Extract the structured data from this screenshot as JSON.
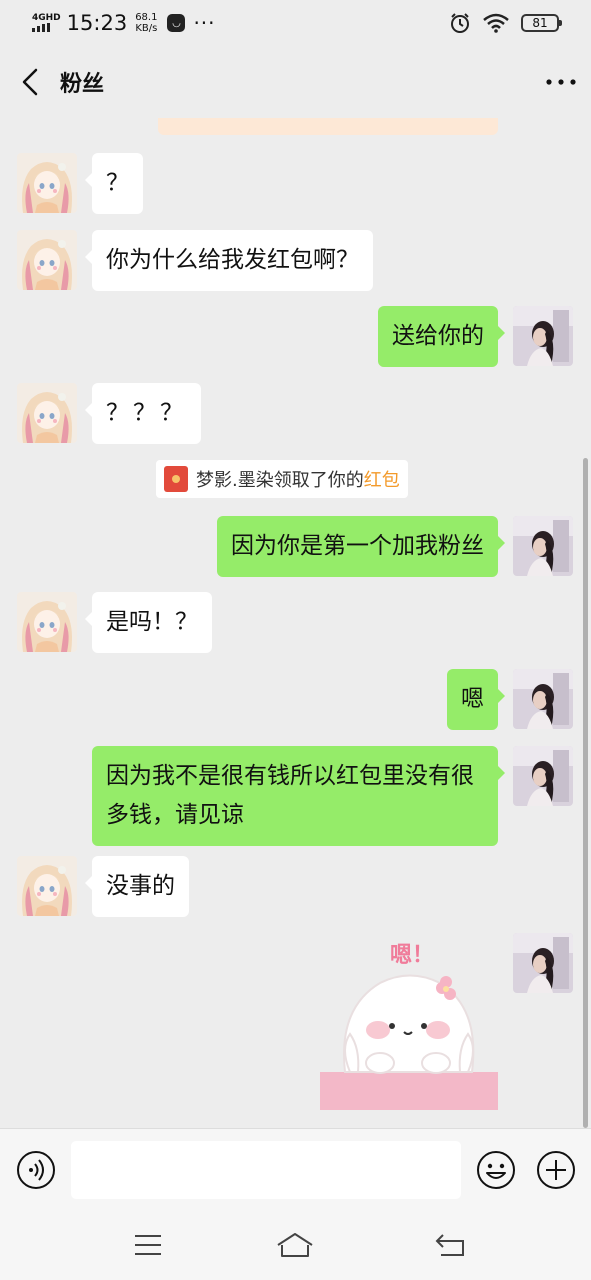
{
  "status_bar": {
    "network": "4GHD",
    "time": "15:23",
    "speed_value": "68.1",
    "speed_unit": "KB/s",
    "battery": "81"
  },
  "header": {
    "title": "粉丝"
  },
  "messages": [
    {
      "side": "in",
      "text": "？"
    },
    {
      "side": "in",
      "text": "你为什么给我发红包啊？"
    },
    {
      "side": "out",
      "text": "送给你的"
    },
    {
      "side": "in",
      "text": "？？？"
    },
    {
      "side": "out",
      "text": "因为你是第一个加我粉丝"
    },
    {
      "side": "in",
      "text": "是吗！？"
    },
    {
      "side": "out",
      "text": "嗯"
    },
    {
      "side": "out",
      "text": "因为我不是很有钱所以红包里没有很多钱，请见谅"
    },
    {
      "side": "in",
      "text": "没事的"
    }
  ],
  "system_notice": {
    "text": "梦影.墨染领取了你的",
    "link": "红包"
  },
  "sticker": {
    "text": "嗯！"
  },
  "icons": {
    "back": "back-arrow-icon",
    "more": "more-icon",
    "voice": "voice-icon",
    "emoji": "emoji-icon",
    "plus": "plus-icon",
    "menu": "menu-icon",
    "home": "home-icon",
    "return": "return-icon"
  },
  "colors": {
    "outgoing_bubble": "#95ec69",
    "incoming_bubble": "#ffffff",
    "background": "#ededed",
    "red_packet_link": "#f39a2a"
  }
}
